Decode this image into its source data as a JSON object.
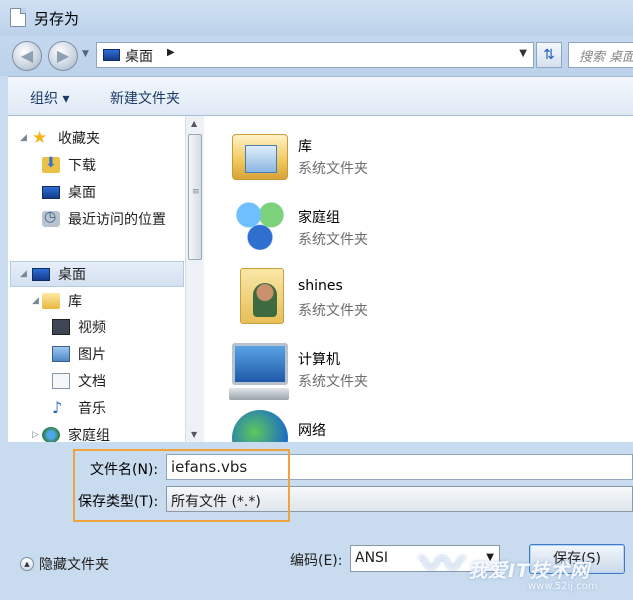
{
  "window": {
    "title": "另存为"
  },
  "address": {
    "location": "桌面",
    "search_placeholder": "搜索 桌面"
  },
  "toolbar": {
    "organize": "组织 ▾",
    "new_folder": "新建文件夹"
  },
  "nav_pane": {
    "favorites": {
      "label": "收藏夹",
      "items": [
        "下载",
        "桌面",
        "最近访问的位置"
      ]
    },
    "desktop": "桌面",
    "library": {
      "label": "库",
      "items": [
        "视频",
        "图片",
        "文档",
        "音乐"
      ]
    },
    "homegroup": "家庭组"
  },
  "files": [
    {
      "name": "库",
      "type": "系统文件夹",
      "icon": "library-icon"
    },
    {
      "name": "家庭组",
      "type": "系统文件夹",
      "icon": "homegroup-icon"
    },
    {
      "name": "shines",
      "type": "系统文件夹",
      "icon": "user-folder-icon"
    },
    {
      "name": "计算机",
      "type": "系统文件夹",
      "icon": "computer-icon"
    },
    {
      "name": "网络",
      "type": "",
      "icon": "network-icon"
    }
  ],
  "form": {
    "filename_label": "文件名(N):",
    "filename_value": "iefans.vbs",
    "filetype_label": "保存类型(T):",
    "filetype_value": "所有文件  (*.*)"
  },
  "footer": {
    "hide_folders": "隐藏文件夹",
    "encoding_label": "编码(E):",
    "encoding_value": "ANSI",
    "save_button": "保存(S)"
  },
  "watermark": {
    "text": "我爱IT技术网",
    "url": "www.52ij.com"
  },
  "colors": {
    "highlight": "#f0a23c",
    "accent": "#3d7bc9"
  }
}
